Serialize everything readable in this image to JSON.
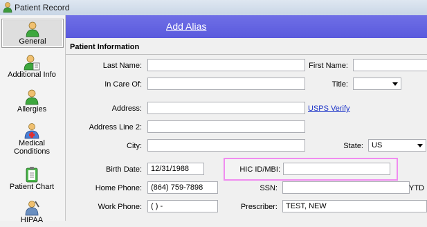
{
  "window": {
    "title": "Patient Record"
  },
  "sidebar": {
    "items": [
      {
        "label": "General",
        "icon": "person-green-icon"
      },
      {
        "label": "Additional Info",
        "icon": "person-info-icon"
      },
      {
        "label": "Allergies",
        "icon": "person-green-icon"
      },
      {
        "label": "Medical Conditions",
        "label_line1": "Medical",
        "label_line2": "Conditions",
        "icon": "medical-cross-icon"
      },
      {
        "label": "Patient Chart",
        "icon": "chart-clipboard-icon"
      },
      {
        "label": "HIPAA",
        "icon": "hipaa-icon"
      }
    ]
  },
  "header": {
    "link": "Add Alias",
    "color": "#6464e2"
  },
  "section": {
    "title": "Patient Information"
  },
  "form": {
    "last_name": {
      "label": "Last Name:",
      "value": ""
    },
    "first_name": {
      "label": "First Name:",
      "value": ""
    },
    "in_care_of": {
      "label": "In Care Of:",
      "value": ""
    },
    "title": {
      "label": "Title:",
      "value": ""
    },
    "address": {
      "label": "Address:",
      "value": ""
    },
    "usps_verify": "USPS Verify",
    "address2": {
      "label": "Address Line 2:",
      "value": ""
    },
    "city": {
      "label": "City:",
      "value": ""
    },
    "state": {
      "label": "State:",
      "value": "US"
    },
    "birth_date": {
      "label": "Birth Date:",
      "value": "12/31/1988"
    },
    "hic_id": {
      "label": "HIC ID/MBI:",
      "value": ""
    },
    "home_phone": {
      "label": "Home Phone:",
      "value": "(864) 759-7898"
    },
    "ssn": {
      "label": "SSN:",
      "value": ""
    },
    "ytd": "YTD",
    "work_phone": {
      "label": "Work Phone:",
      "value": "(  )   -"
    },
    "prescriber": {
      "label": "Prescriber:",
      "value": "TEST, NEW"
    }
  }
}
